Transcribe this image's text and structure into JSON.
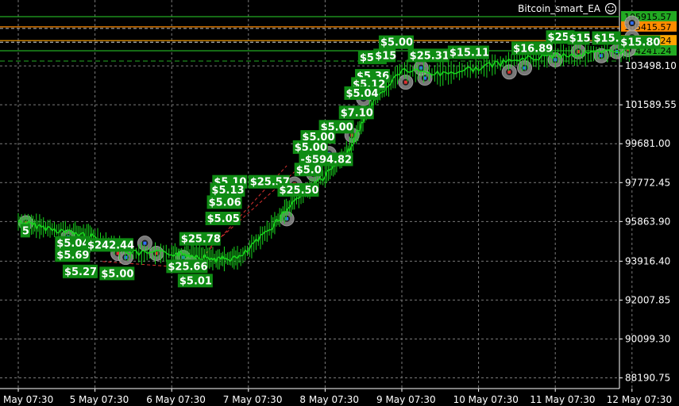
{
  "chart_data": {
    "type": "line",
    "title": "Bitcoin_smart_EA",
    "ylim": [
      87600,
      106800
    ],
    "y_ticks": [
      "105915.57",
      "103498.10",
      "101589.55",
      "99681.00",
      "97772.45",
      "95863.90",
      "93916.40",
      "92007.85",
      "90099.30",
      "88190.75"
    ],
    "x_ticks": [
      "May 07:30",
      "5 May 07:30",
      "6 May 07:30",
      "7 May 07:30",
      "8 May 07:30",
      "9 May 07:30",
      "10 May 07:30",
      "11 May 07:30",
      "12 May 07:30"
    ],
    "grid": true,
    "price_levels": [
      {
        "value": 105915.57,
        "label": "105915.57",
        "color": "#22aa22"
      },
      {
        "value": 105415.57,
        "label": "105415.57",
        "color": "#ff8c00"
      },
      {
        "value": 104741.24,
        "label": "104741.24",
        "color": "#ffa500"
      },
      {
        "value": 104241.24,
        "label": "104241.24",
        "color": "#22aa22"
      }
    ],
    "series": [
      {
        "values": [
          [
            0,
            95850
          ],
          [
            0.3,
            95600
          ],
          [
            0.7,
            95300
          ],
          [
            1.0,
            95100
          ],
          [
            1.5,
            94300
          ],
          [
            2.0,
            94300
          ],
          [
            2.3,
            94200
          ],
          [
            2.6,
            94000
          ],
          [
            2.9,
            94100
          ],
          [
            3.3,
            95600
          ],
          [
            3.6,
            96900
          ],
          [
            4.0,
            98100
          ],
          [
            4.3,
            99300
          ],
          [
            4.6,
            101600
          ],
          [
            5.0,
            103300
          ],
          [
            5.5,
            103100
          ],
          [
            6.0,
            103400
          ],
          [
            6.5,
            103800
          ],
          [
            7.0,
            104000
          ],
          [
            7.5,
            104100
          ],
          [
            8.0,
            104300
          ]
        ]
      }
    ],
    "annotations": [
      {
        "text": "$5.00",
        "x": 4.72,
        "y": 104450
      },
      {
        "text": "$5.9",
        "x": 4.45,
        "y": 103700
      },
      {
        "text": "$15",
        "x": 4.65,
        "y": 103800
      },
      {
        "text": "$25.31",
        "x": 5.1,
        "y": 103800
      },
      {
        "text": "$15.11",
        "x": 5.62,
        "y": 103950
      },
      {
        "text": "$16.89",
        "x": 6.45,
        "y": 104150
      },
      {
        "text": "$25.",
        "x": 6.9,
        "y": 104700
      },
      {
        "text": "$15",
        "x": 7.18,
        "y": 104650
      },
      {
        "text": "$15.",
        "x": 7.5,
        "y": 104650
      },
      {
        "text": "$15.80",
        "x": 7.85,
        "y": 104450
      },
      {
        "text": "$5.36",
        "x": 4.41,
        "y": 102800
      },
      {
        "text": "$5.12",
        "x": 4.36,
        "y": 102400
      },
      {
        "text": "$5.04",
        "x": 4.27,
        "y": 101950
      },
      {
        "text": "$7.10",
        "x": 4.2,
        "y": 101000
      },
      {
        "text": "$5.00",
        "x": 3.94,
        "y": 100300
      },
      {
        "text": "$5.00",
        "x": 3.7,
        "y": 99800
      },
      {
        "text": "$5.00",
        "x": 3.6,
        "y": 99300
      },
      {
        "text": "-$594.82",
        "x": 3.68,
        "y": 98700
      },
      {
        "text": "$5.0",
        "x": 3.62,
        "y": 98200
      },
      {
        "text": "$5.10",
        "x": 2.55,
        "y": 97600
      },
      {
        "text": "$25.57",
        "x": 3.02,
        "y": 97600
      },
      {
        "text": "$5.13",
        "x": 2.52,
        "y": 97200
      },
      {
        "text": "$25.50",
        "x": 3.4,
        "y": 97200
      },
      {
        "text": "$5.06",
        "x": 2.48,
        "y": 96600
      },
      {
        "text": "$5.05",
        "x": 2.46,
        "y": 95800
      },
      {
        "text": "$25.78",
        "x": 2.12,
        "y": 94800
      },
      {
        "text": "$5.04",
        "x": 0.5,
        "y": 94600
      },
      {
        "text": "$242.44",
        "x": 0.9,
        "y": 94500
      },
      {
        "text": "$5.69",
        "x": 0.5,
        "y": 94000
      },
      {
        "text": "$5.27",
        "x": 0.6,
        "y": 93200
      },
      {
        "text": "$5.00",
        "x": 1.08,
        "y": 93100
      },
      {
        "text": "$25.66",
        "x": 1.95,
        "y": 93450
      },
      {
        "text": "$5.01",
        "x": 2.1,
        "y": 92750
      },
      {
        "text": "5",
        "x": 0.05,
        "y": 95200
      }
    ],
    "trade_markers": [
      [
        0.1,
        95800
      ],
      [
        0.65,
        95100
      ],
      [
        0.85,
        94500
      ],
      [
        1.3,
        94300
      ],
      [
        1.4,
        94100
      ],
      [
        1.65,
        94800
      ],
      [
        1.8,
        94300
      ],
      [
        2.15,
        94100
      ],
      [
        2.25,
        93800
      ],
      [
        2.7,
        97000
      ],
      [
        2.8,
        97300
      ],
      [
        3.5,
        96000
      ],
      [
        3.6,
        97700
      ],
      [
        3.85,
        98200
      ],
      [
        4.05,
        99200
      ],
      [
        4.35,
        100100
      ],
      [
        4.5,
        101900
      ],
      [
        4.6,
        102700
      ],
      [
        5.05,
        102700
      ],
      [
        5.3,
        102900
      ],
      [
        5.25,
        103400
      ],
      [
        6.4,
        103200
      ],
      [
        6.6,
        103400
      ],
      [
        7.0,
        103800
      ],
      [
        7.3,
        104200
      ],
      [
        7.6,
        104000
      ],
      [
        7.8,
        104200
      ],
      [
        7.95,
        104300
      ],
      [
        8.0,
        104900
      ],
      [
        8.0,
        105600
      ]
    ]
  }
}
